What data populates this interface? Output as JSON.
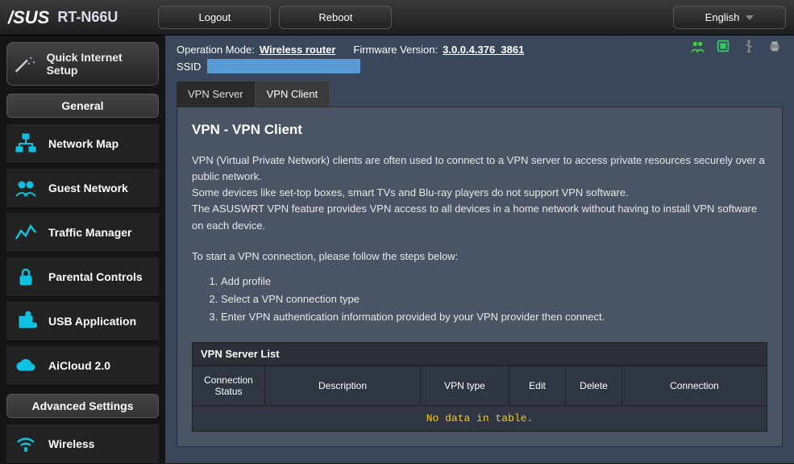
{
  "brand": "/SUS",
  "model": "RT-N66U",
  "top_buttons": {
    "logout": "Logout",
    "reboot": "Reboot",
    "language": "English"
  },
  "info": {
    "op_mode_label": "Operation Mode:",
    "op_mode_value": "Wireless router",
    "fw_label": "Firmware Version:",
    "fw_value": "3.0.0.4.376_3861",
    "ssid_label": "SSID"
  },
  "status_icons": [
    "users-icon",
    "network-layers-icon",
    "usb-icon",
    "printer-icon"
  ],
  "qis": "Quick Internet Setup",
  "sections": {
    "general": "General",
    "advanced": "Advanced Settings"
  },
  "nav_general": [
    {
      "key": "network-map",
      "label": "Network Map"
    },
    {
      "key": "guest-network",
      "label": "Guest Network"
    },
    {
      "key": "traffic-manager",
      "label": "Traffic Manager"
    },
    {
      "key": "parental-controls",
      "label": "Parental Controls"
    },
    {
      "key": "usb-application",
      "label": "USB Application"
    },
    {
      "key": "aicloud",
      "label": "AiCloud 2.0"
    }
  ],
  "nav_advanced": [
    {
      "key": "wireless",
      "label": "Wireless"
    }
  ],
  "tabs": {
    "server": "VPN Server",
    "client": "VPN Client"
  },
  "panel": {
    "title": "VPN - VPN Client",
    "p1": "VPN (Virtual Private Network) clients are often used to connect to a VPN server to access private resources securely over a public network.",
    "p2": "Some devices like set-top boxes, smart TVs and Blu-ray players do not support VPN software.",
    "p3": "The ASUSWRT VPN feature provides VPN access to all devices in a home network without having to install VPN software on each device.",
    "p4": "To start a VPN connection, please follow the steps below:",
    "steps": [
      "Add profile",
      "Select a VPN connection type",
      "Enter VPN authentication information provided by your VPN provider then connect."
    ]
  },
  "list": {
    "title": "VPN Server List",
    "columns": [
      "Connection Status",
      "Description",
      "VPN type",
      "Edit",
      "Delete",
      "Connection"
    ],
    "empty": "No data in table."
  }
}
